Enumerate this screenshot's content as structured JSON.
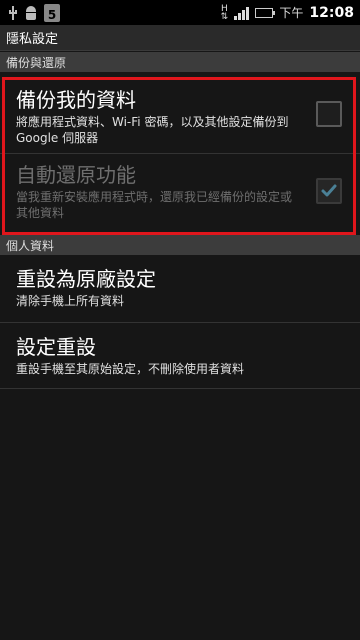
{
  "status_bar": {
    "calendar_day": "5",
    "network_type": "H",
    "ampm": "下午",
    "time": "12:08",
    "icons": [
      "usb-icon",
      "android-debug-icon",
      "calendar-icon",
      "hspa-icon",
      "signal-icon",
      "battery-icon"
    ]
  },
  "title": "隱私設定",
  "sections": [
    {
      "header": "備份與還原",
      "items": [
        {
          "title": "備份我的資料",
          "summary": "將應用程式資料、Wi-Fi 密碼，以及其他設定備份到 Google 伺服器",
          "checked": false,
          "enabled": true
        },
        {
          "title": "自動還原功能",
          "summary": "當我重新安裝應用程式時，還原我已經備份的設定或其他資料",
          "checked": true,
          "enabled": false
        }
      ]
    },
    {
      "header": "個人資料",
      "items": [
        {
          "title": "重設為原廠設定",
          "summary": "清除手機上所有資料"
        },
        {
          "title": "設定重設",
          "summary": "重設手機至其原始設定，不刪除使用者資料"
        }
      ]
    }
  ],
  "colors": {
    "highlight": "#e0161c",
    "battery": "#8bd43a",
    "background": "#161616"
  }
}
